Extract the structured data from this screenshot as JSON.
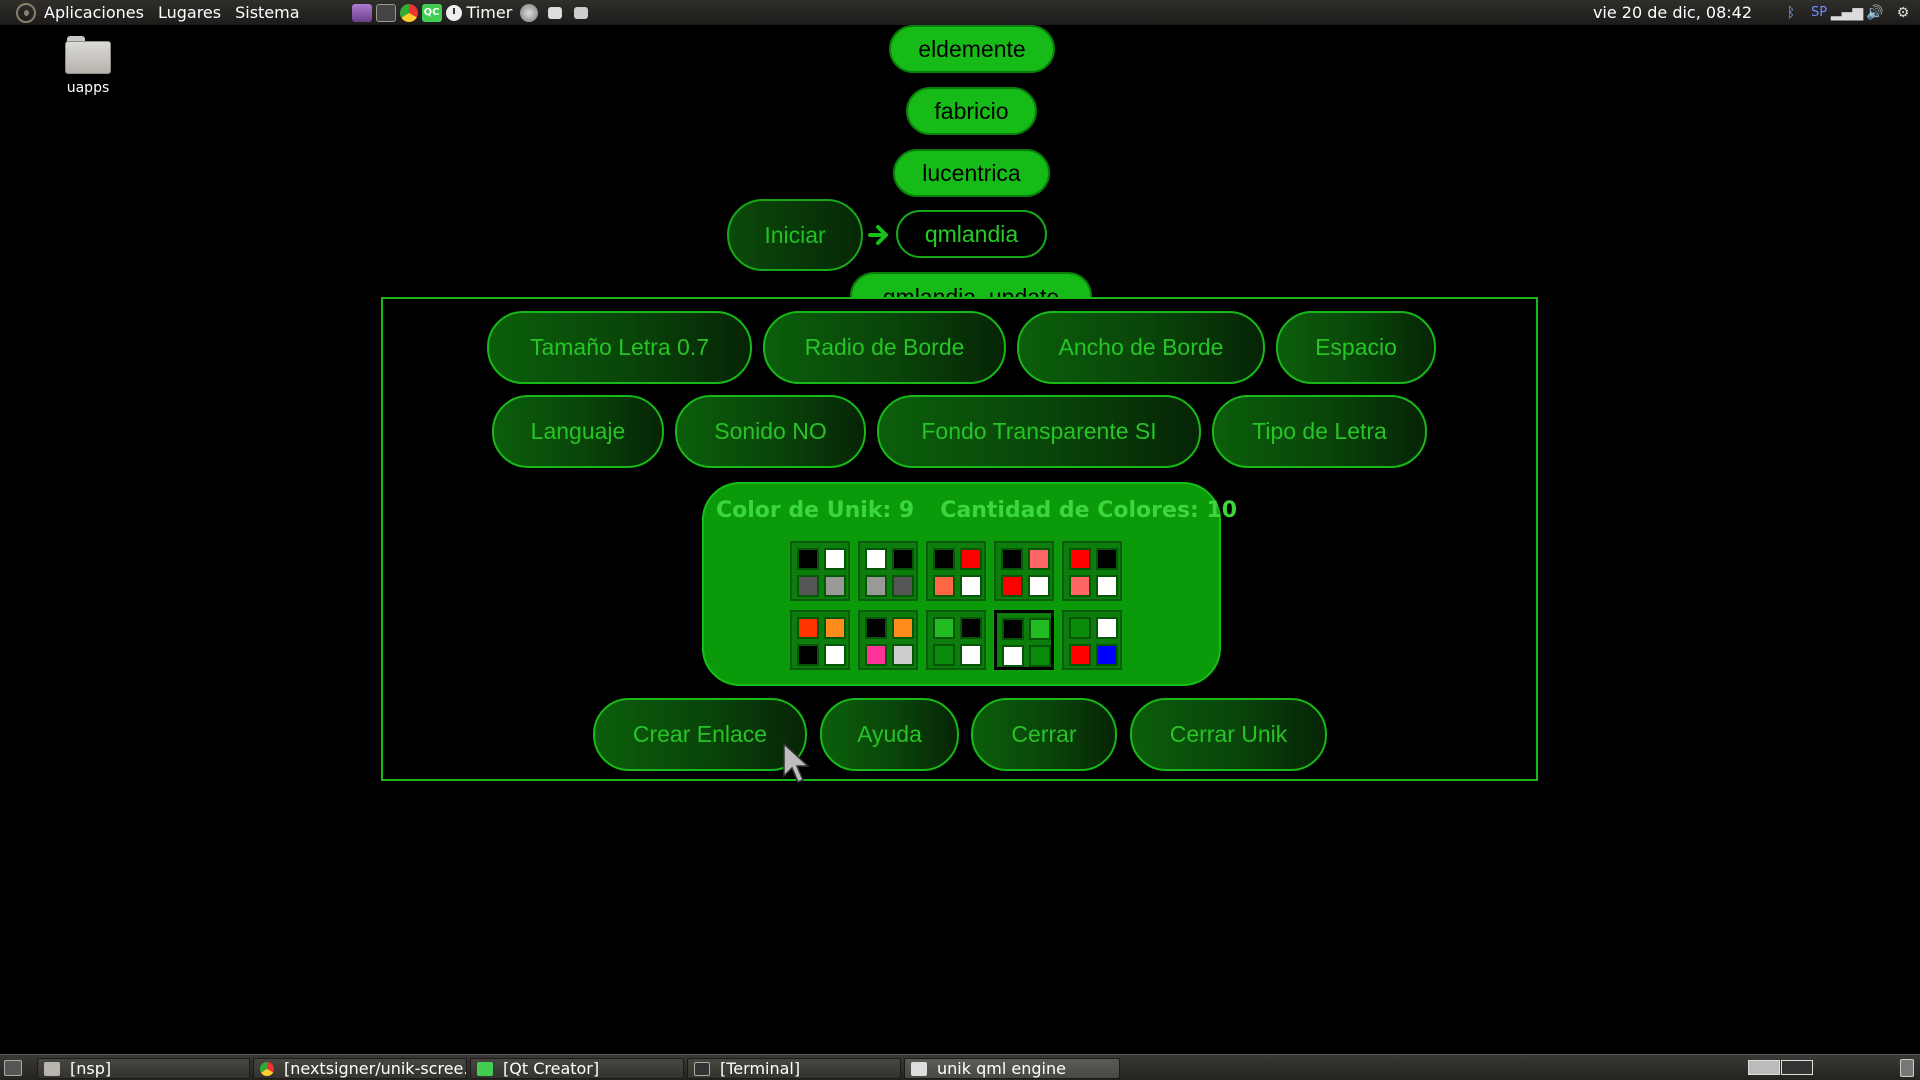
{
  "top_panel": {
    "menus": [
      "Aplicaciones",
      "Lugares",
      "Sistema"
    ],
    "timer_label": "Timer",
    "clock": "vie 20 de dic, 08:42",
    "keyboard_layout": "SP"
  },
  "desktop": {
    "icon_label": "uapps"
  },
  "launcher": {
    "items": [
      "eldemente",
      "fabricio",
      "lucentrica",
      "qmlandia",
      "qmlandia_update"
    ],
    "start_label": "Iniciar"
  },
  "settings": {
    "row1": [
      "Tamaño Letra 0.7",
      "Radio de Borde",
      "Ancho de Borde",
      "Espacio"
    ],
    "row2": [
      "Languaje",
      "Sonido NO",
      "Fondo Transparente SI",
      "Tipo de Letra"
    ],
    "row3": [
      "Crear Enlace",
      "Ayuda",
      "Cerrar",
      "Cerrar Unik"
    ],
    "color_label": "Color de Unik: 9",
    "color_count_label": "Cantidad de Colores: 10",
    "selected_color_index": 8,
    "color_schemes": [
      [
        "#000000",
        "#ffffff",
        "#555555",
        "#999999"
      ],
      [
        "#ffffff",
        "#000000",
        "#999999",
        "#555555"
      ],
      [
        "#000000",
        "#ff0000",
        "#ff6644",
        "#ffffff"
      ],
      [
        "#000000",
        "#ff6666",
        "#ff0000",
        "#ffffff"
      ],
      [
        "#ff0000",
        "#000000",
        "#ff6666",
        "#ffffff"
      ],
      [
        "#ff3300",
        "#ff8c1a",
        "#000000",
        "#ffffff"
      ],
      [
        "#000000",
        "#ff8c1a",
        "#ff3399",
        "#cccccc"
      ],
      [
        "#22bb22",
        "#000000",
        "#0a8a0a",
        "#ffffff"
      ],
      [
        "#000000",
        "#22bb22",
        "#ffffff",
        "#0a8a0a"
      ],
      [
        "#0a8a0a",
        "#ffffff",
        "#ff0000",
        "#0000ff"
      ]
    ]
  },
  "taskbar": {
    "tasks": [
      "[nsp]",
      "[nextsigner/unik-scree...",
      "[Qt Creator]",
      "[Terminal]",
      "unik qml engine"
    ],
    "active_task_index": 4
  },
  "colors": {
    "accent_green": "#17bb17",
    "panel_border": "#17b817",
    "background": "#000000"
  }
}
